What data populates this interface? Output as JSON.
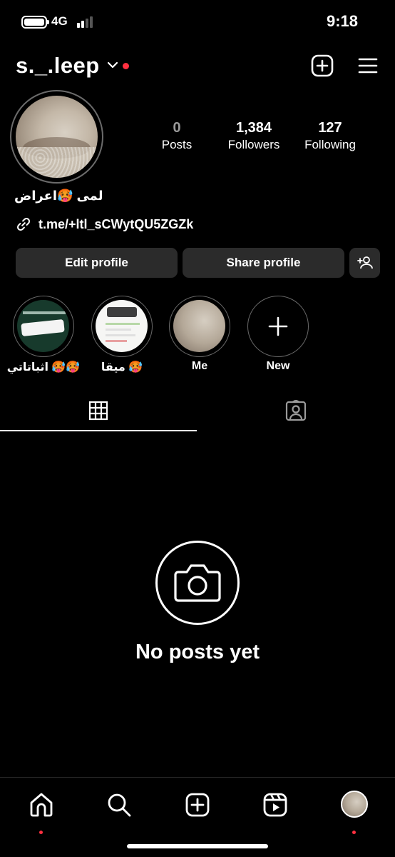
{
  "status_bar": {
    "network": "4G",
    "time": "9:18"
  },
  "header": {
    "username": "s._.leep"
  },
  "profile": {
    "display_name": "لمى 🥵اعراض",
    "link": "t.me/+ltl_sCWytQU5ZGZk"
  },
  "stats": [
    {
      "value": "0",
      "label": "Posts"
    },
    {
      "value": "1,384",
      "label": "Followers"
    },
    {
      "value": "127",
      "label": "Following"
    }
  ],
  "buttons": {
    "edit": "Edit profile",
    "share": "Share profile"
  },
  "highlights": [
    {
      "label": "اثباتاتي 🥵🥵"
    },
    {
      "label": "ميقا 🥵"
    },
    {
      "label": "Me"
    },
    {
      "label": "New"
    }
  ],
  "empty_state": {
    "title": "No posts yet"
  },
  "colors": {
    "background": "#000000",
    "button": "#2b2b2b",
    "notification": "#ff3040"
  },
  "icons": [
    "chevron-down-icon",
    "new-post-icon",
    "menu-icon",
    "link-icon",
    "add-person-icon",
    "grid-icon",
    "tagged-icon",
    "camera-icon",
    "home-icon",
    "search-icon",
    "create-icon",
    "reels-icon"
  ]
}
